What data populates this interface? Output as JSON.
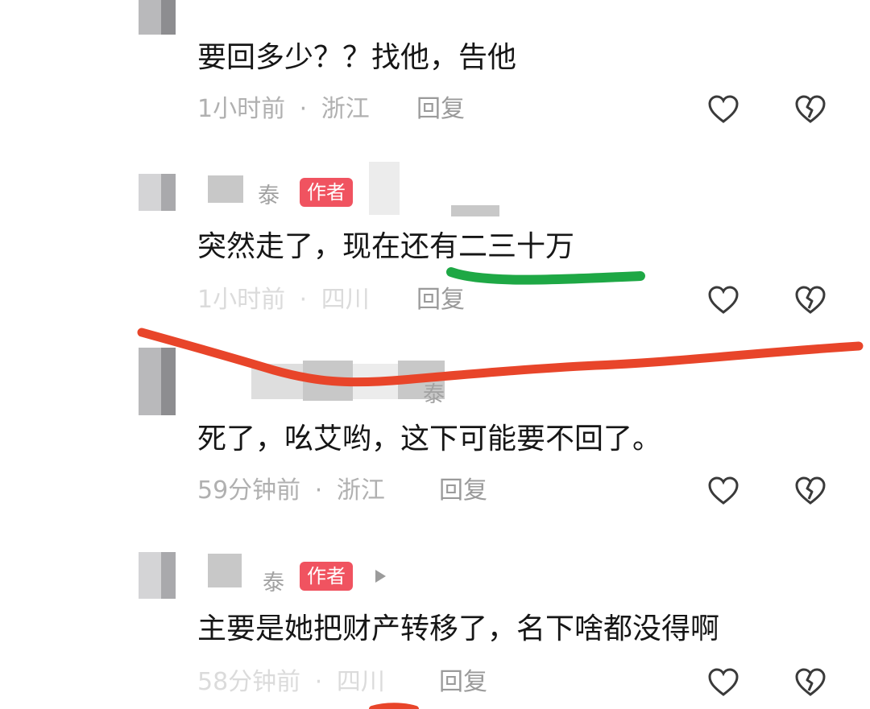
{
  "comments": [
    {
      "content": "要回多少？？找他，告他",
      "time": "1小时前",
      "location": "浙江",
      "reply_label": "回复"
    },
    {
      "username_fragment": "泰",
      "badge": "作者",
      "content": "突然走了，现在还有二三十万",
      "time": "1小时前",
      "location": "四川",
      "reply_label": "回复"
    },
    {
      "username_fragment": "泰",
      "content": "死了，吆艾哟，这下可能要不回了。",
      "time": "59分钟前",
      "location": "浙江",
      "reply_label": "回复"
    },
    {
      "username_fragment": "泰",
      "badge": "作者",
      "content": "主要是她把财产转移了，名下啥都没得啊",
      "time": "58分钟前",
      "location": "四川",
      "reply_label": "回复"
    }
  ],
  "separator_dot": "·",
  "icons": {
    "like": "heart-outline-icon",
    "dislike": "broken-heart-icon",
    "author_badge_arrow": "play-triangle-icon"
  },
  "colors": {
    "author_badge": "#f05360",
    "green_underline": "#1ea845",
    "red_scribble": "#e8452a"
  }
}
